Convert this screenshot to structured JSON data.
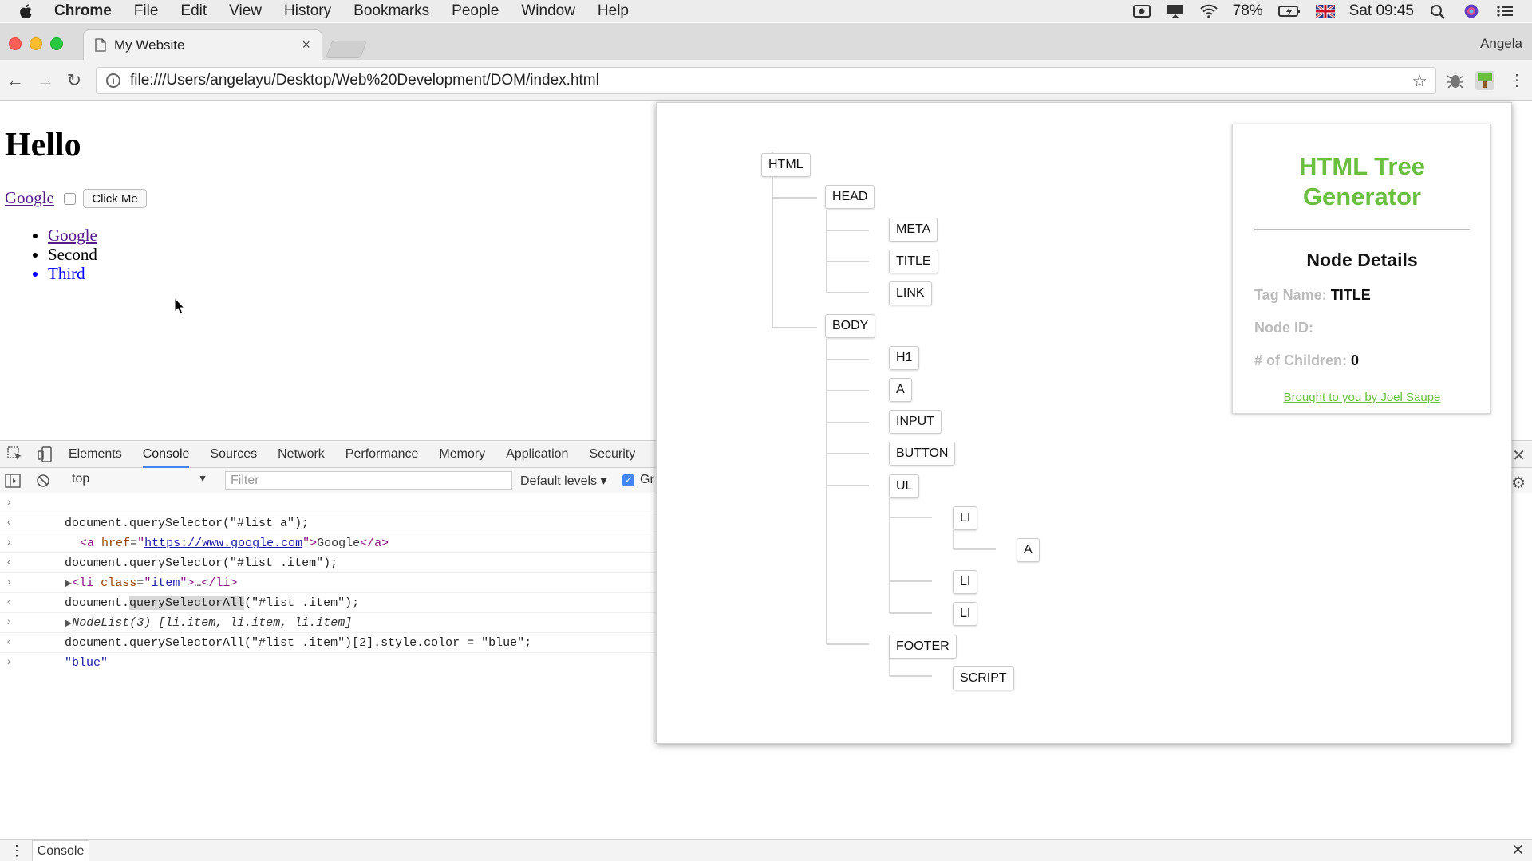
{
  "menubar": {
    "app": "Chrome",
    "items": [
      "File",
      "Edit",
      "View",
      "History",
      "Bookmarks",
      "People",
      "Window",
      "Help"
    ],
    "battery": "78%",
    "clock": "Sat 09:45"
  },
  "browser": {
    "tab_title": "My Website",
    "profile": "Angela",
    "url": "file:///Users/angelayu/Desktop/Web%20Development/DOM/index.html"
  },
  "page": {
    "heading": "Hello",
    "link": "Google",
    "button": "Click Me",
    "list": [
      "Google",
      "Second",
      "Third"
    ]
  },
  "devtools": {
    "tabs": [
      "Elements",
      "Console",
      "Sources",
      "Network",
      "Performance",
      "Memory",
      "Application",
      "Security"
    ],
    "active_tab": "Console",
    "context": "top",
    "filter_placeholder": "Filter",
    "levels": "Default levels",
    "group_label": "Gr",
    "console": {
      "l1": "document.querySelector(\"#list a\");",
      "l2_url": "https://www.google.com",
      "l2_text": "Google",
      "l3": "document.querySelector(\"#list .item\");",
      "l4_class": "item",
      "l5_pre": "document.",
      "l5_hl": "querySelectorAll",
      "l5_post": "(\"#list .item\");",
      "l6": "NodeList(3) [li.item, li.item, li.item]",
      "l7": "document.querySelectorAll(\"#list .item\")[2].style.color = \"blue\";",
      "l8": "\"blue\""
    },
    "drawer_tab": "Console"
  },
  "tree": {
    "nodes": [
      "HTML",
      "HEAD",
      "META",
      "TITLE",
      "LINK",
      "BODY",
      "H1",
      "A",
      "INPUT",
      "BUTTON",
      "UL",
      "LI",
      "A",
      "LI",
      "LI",
      "FOOTER",
      "SCRIPT"
    ]
  },
  "details": {
    "title_line1": "HTML Tree",
    "title_line2": "Generator",
    "heading": "Node Details",
    "tag_label": "Tag Name:",
    "tag_value": "TITLE",
    "id_label": "Node ID:",
    "id_value": "",
    "children_label": "# of Children:",
    "children_value": "0",
    "credit": "Brought to you by Joel Saupe"
  },
  "colors": {
    "accent_green": "#6abf40",
    "console_prompt": "#4285f4",
    "visited_link": "#551a8b"
  }
}
